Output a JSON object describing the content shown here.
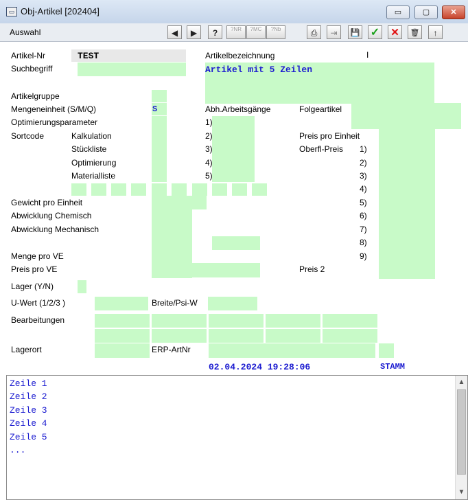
{
  "window": {
    "title": "Obj-Artikel  [202404]",
    "minimize": "▭",
    "maximize": "▢",
    "close": "✕"
  },
  "menu": {
    "auswahl": "Auswahl"
  },
  "toolbar": {
    "prev": "◀",
    "next": "▶",
    "help": "?",
    "btn_nr": "?NR",
    "btn_mc": "?MC",
    "btn_nb": "?Nb",
    "print": "⎙",
    "export": "⇥",
    "save": "💾",
    "ok": "✓",
    "cancel": "✕",
    "delete": "🗑",
    "up": "↑"
  },
  "labels": {
    "artikel_nr": "Artikel-Nr",
    "suchbegriff": "Suchbegriff",
    "artikelbezeichnung": "Artikelbezeichnung",
    "artikelgruppe": "Artikelgruppe",
    "mengeneinheit": "Mengeneinheit (S/M/Q)",
    "abh_arbeitsgaenge": "Abh.Arbeitsgänge",
    "folgeartikel": "Folgeartikel",
    "optimierungsparameter": "Optimierungsparameter",
    "sortcode": "Sortcode",
    "kalkulation": "Kalkulation",
    "stueckliste": "Stückliste",
    "optimierung": "Optimierung",
    "materialliste": "Materialliste",
    "preis_pro_einheit": "Preis pro Einheit",
    "oberfl_preis": "Oberfl-Preis",
    "gewicht_pro_einheit": "Gewicht pro Einheit",
    "abwicklung_chemisch": "Abwicklung Chemisch",
    "abwicklung_mechanisch": "Abwicklung Mechanisch",
    "menge_pro_ve": "Menge pro VE",
    "preis_pro_ve": "Preis pro VE",
    "preis_2": "Preis 2",
    "lager": "Lager (Y/N)",
    "u_wert": "U-Wert (1/2/3 )",
    "breite_psi_w": "Breite/Psi-W",
    "bearbeitungen": "Bearbeitungen",
    "lagerort": "Lagerort",
    "erp_artnr": "ERP-ArtNr"
  },
  "abh_numbers": [
    "1)",
    "2)",
    "3)",
    "4)",
    "5)"
  ],
  "oberfl_numbers": [
    "1)",
    "2)",
    "3)",
    "4)",
    "5)",
    "6)",
    "7)",
    "8)",
    "9)"
  ],
  "values": {
    "artikel_nr": "TEST",
    "artikelbezeichnung": "Artikel mit 5 Zeilen",
    "artikelbezeichnung_cursor": "I",
    "mengeneinheit": "S",
    "timestamp": "02.04.2024 19:28:06",
    "status": "STAMM"
  },
  "memo": {
    "lines": [
      "Zeile 1",
      "Zeile 2",
      "Zeile 3",
      "Zeile 4",
      "Zeile 5",
      "..."
    ]
  },
  "colors": {
    "field_bg": "#c8fac8",
    "value_blue": "#1b1bd0"
  }
}
